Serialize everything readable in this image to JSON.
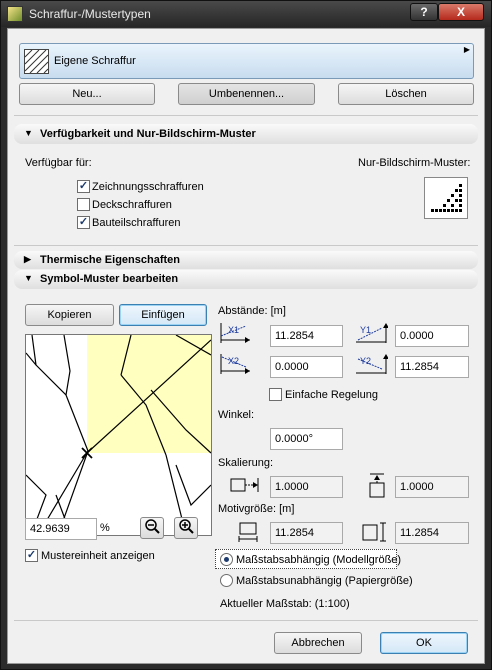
{
  "window": {
    "title": "Schraffur-/Mustertypen",
    "help": "?",
    "close": "X"
  },
  "hatch": {
    "name": "Eigene Schraffur"
  },
  "actions": {
    "new": "Neu...",
    "rename": "Umbenennen...",
    "delete": "Löschen"
  },
  "availability": {
    "header": "Verfügbarkeit und Nur-Bildschirm-Muster",
    "available_for": "Verfügbar für:",
    "screen_only": "Nur-Bildschirm-Muster:",
    "items": [
      {
        "label": "Zeichnungsschraffuren",
        "checked": true
      },
      {
        "label": "Deckschraffuren",
        "checked": false
      },
      {
        "label": "Bauteilschraffuren",
        "checked": true
      }
    ]
  },
  "thermal": {
    "header": "Thermische Eigenschaften"
  },
  "symbol": {
    "header": "Symbol-Muster bearbeiten",
    "copy": "Kopieren",
    "paste": "Einfügen",
    "zoom_value": "42.9639",
    "zoom_unit": "%",
    "show_unit_label": "Mustereinheit anzeigen",
    "show_unit_checked": true,
    "spacing_label": "Abstände: [m]",
    "x1": "11.2854",
    "y1": "0.0000",
    "x2": "0.0000",
    "y2": "11.2854",
    "x1_tag": "X1",
    "y1_tag": "Y1",
    "x2_tag": "X2",
    "y2_tag": "Y2",
    "simple_label": "Einfache Regelung",
    "angle_label": "Winkel:",
    "angle": "0.0000°",
    "scale_label": "Skalierung:",
    "scale_x": "1.0000",
    "scale_y": "1.0000",
    "motif_label": "Motivgröße: [m]",
    "motif_w": "11.2854",
    "motif_h": "11.2854",
    "scale_dependent": "Maßstabsabhängig (Modellgröße)",
    "scale_independent": "Maßstabsunabhängig (Papiergröße)",
    "current_scale": "Aktueller Maßstab: (1:100)"
  },
  "footer": {
    "cancel": "Abbrechen",
    "ok": "OK"
  },
  "colors": {
    "pattern_fill": "#ffffc0",
    "accent": "#3c7fb1"
  }
}
